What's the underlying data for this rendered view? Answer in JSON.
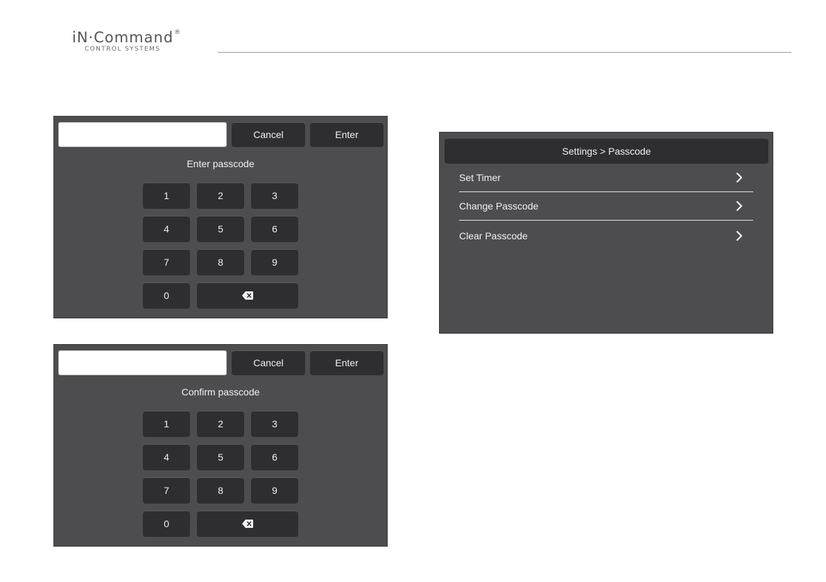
{
  "header": {
    "brand": "iN·Command",
    "registered_mark": "®",
    "tagline": "CONTROL SYSTEMS"
  },
  "keypad_enter": {
    "input_value": "",
    "cancel_label": "Cancel",
    "enter_label": "Enter",
    "prompt": "Enter passcode",
    "keys": [
      "1",
      "2",
      "3",
      "4",
      "5",
      "6",
      "7",
      "8",
      "9",
      "0"
    ],
    "backspace_icon": "backspace-icon"
  },
  "keypad_confirm": {
    "input_value": "",
    "cancel_label": "Cancel",
    "enter_label": "Enter",
    "prompt": "Confirm passcode",
    "keys": [
      "1",
      "2",
      "3",
      "4",
      "5",
      "6",
      "7",
      "8",
      "9",
      "0"
    ],
    "backspace_icon": "backspace-icon"
  },
  "settings_menu": {
    "title": "Settings > Passcode",
    "items": [
      {
        "label": "Set Timer",
        "icon": "chevron-right-icon"
      },
      {
        "label": "Change Passcode",
        "icon": "chevron-right-icon"
      },
      {
        "label": "Clear Passcode",
        "icon": "chevron-right-icon"
      }
    ]
  },
  "colors": {
    "panel": "#4d4d4f",
    "button": "#2e2e30",
    "text": "#f2f2f2"
  }
}
